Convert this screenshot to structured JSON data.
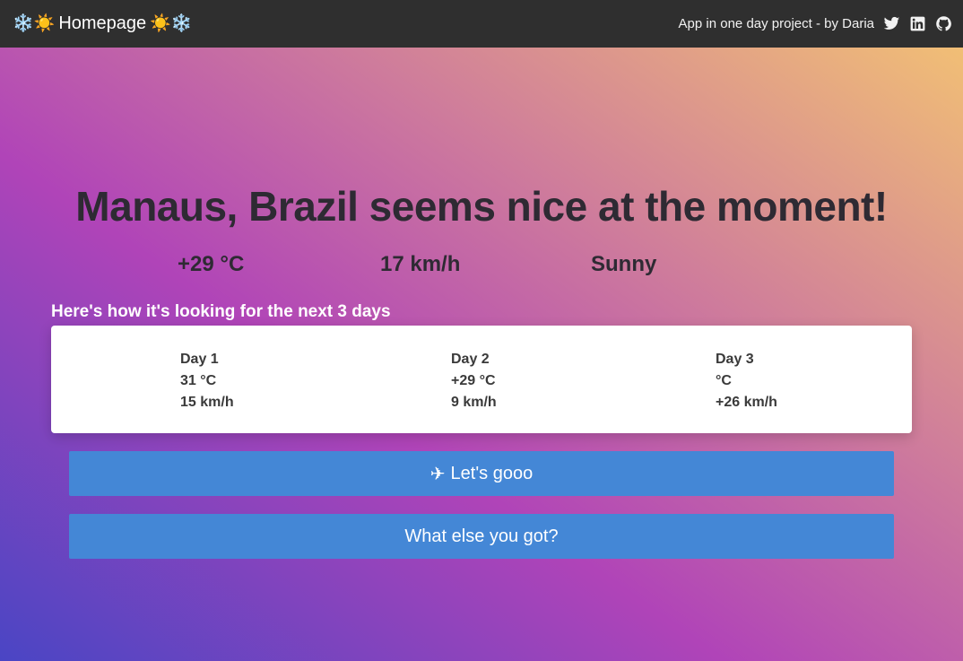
{
  "navbar": {
    "brand_left_emoji": "❄️☀️",
    "brand_label": "Homepage",
    "brand_right_emoji": "☀️❄️",
    "credit": "App in one day project - by Daria",
    "icons": [
      "twitter-icon",
      "linkedin-icon",
      "github-icon"
    ]
  },
  "headline": "Manaus, Brazil seems nice at the moment!",
  "current": {
    "temperature": "+29 °C",
    "wind": "17 km/h",
    "condition": "Sunny"
  },
  "forecast": {
    "title": "Here's how it's looking for the next 3 days",
    "days": [
      {
        "label": "Day 1",
        "temperature": "31 °C",
        "wind": "15 km/h"
      },
      {
        "label": "Day 2",
        "temperature": "+29 °C",
        "wind": "9 km/h"
      },
      {
        "label": "Day 3",
        "temperature": "°C",
        "wind": "+26 km/h"
      }
    ]
  },
  "buttons": {
    "go_icon": "✈",
    "go_label": "Let's gooo",
    "else_label": "What else you got?"
  },
  "colors": {
    "navbar": "#2f2f2f",
    "button": "#4487d6",
    "text_dark": "#2e2a33"
  }
}
